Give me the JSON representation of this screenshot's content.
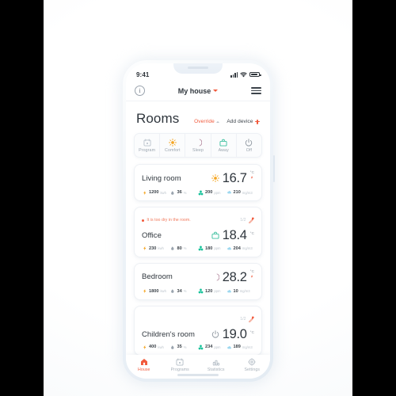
{
  "statusbar": {
    "time": "9:41",
    "signal_icon": "signal-bars-icon",
    "wifi_icon": "wifi-icon",
    "battery_icon": "battery-icon"
  },
  "appbar": {
    "info_icon": "info-icon",
    "info_glyph": "i",
    "title": "My house",
    "caret_icon": "caret-down-icon",
    "menu_icon": "hamburger-menu-icon"
  },
  "header": {
    "title": "Rooms",
    "override_label": "Override",
    "override_chevron": "chevron-up-icon",
    "add_device_label": "Add device",
    "add_device_icon": "plus-icon"
  },
  "modes": [
    {
      "label": "Program",
      "icon": "calendar-icon",
      "color": "#b9c2cb",
      "active": false
    },
    {
      "label": "Comfort",
      "icon": "sun-icon",
      "color": "#f5a623",
      "active": false
    },
    {
      "label": "Sleep",
      "icon": "moon-icon",
      "color": "#a8768f",
      "active": false
    },
    {
      "label": "Away",
      "icon": "briefcase-icon",
      "color": "#3fc0a0",
      "active": false
    },
    {
      "label": "Off",
      "icon": "power-icon",
      "color": "#8d969f",
      "active": false
    }
  ],
  "rooms": [
    {
      "name": "Living room",
      "mode_icon": "sun-icon",
      "mode_color": "#f5a623",
      "temperature": "16.7",
      "unit": "°C",
      "heating_icon": "flame-icon",
      "alert": null,
      "count": null,
      "metrics": [
        {
          "icon": "bolt-icon",
          "color": "#f5a623",
          "value": "1200",
          "unit": "kwh"
        },
        {
          "icon": "humidity-icon",
          "color": "#9aa4ae",
          "value": "36",
          "unit": "%"
        },
        {
          "icon": "co2-icon",
          "color": "#17c29a",
          "value": "200",
          "unit": "ppm"
        },
        {
          "icon": "dust-icon",
          "color": "#9ed8ef",
          "value": "210",
          "unit": "mg/m3"
        }
      ]
    },
    {
      "name": "Office",
      "mode_icon": "briefcase-icon",
      "mode_color": "#3fc0a0",
      "temperature": "18.4",
      "unit": "°C",
      "heating_icon": null,
      "alert": "It is too dry in the room.",
      "count": "1/2",
      "count_icon": "dry-air-icon",
      "metrics": [
        {
          "icon": "bolt-icon",
          "color": "#f5a623",
          "value": "230",
          "unit": "kwh"
        },
        {
          "icon": "humidity-icon",
          "color": "#9aa4ae",
          "value": "80",
          "unit": "%"
        },
        {
          "icon": "co2-icon",
          "color": "#17c29a",
          "value": "180",
          "unit": "ppm"
        },
        {
          "icon": "dust-icon",
          "color": "#9ed8ef",
          "value": "204",
          "unit": "mg/m3"
        }
      ]
    },
    {
      "name": "Bedroom",
      "mode_icon": "moon-icon",
      "mode_color": "#a8768f",
      "temperature": "28.2",
      "unit": "°C",
      "heating_icon": "flame-icon",
      "alert": null,
      "count": null,
      "metrics": [
        {
          "icon": "bolt-icon",
          "color": "#f5a623",
          "value": "1800",
          "unit": "kwh"
        },
        {
          "icon": "humidity-icon",
          "color": "#9aa4ae",
          "value": "34",
          "unit": "%"
        },
        {
          "icon": "co2-icon",
          "color": "#17c29a",
          "value": "120",
          "unit": "ppm"
        },
        {
          "icon": "dust-icon",
          "color": "#9ed8ef",
          "value": "10",
          "unit": "mg/m3"
        }
      ]
    },
    {
      "name": "Children's room",
      "mode_icon": "power-icon",
      "mode_color": "#8d969f",
      "temperature": "19.0",
      "unit": "°C",
      "heating_icon": null,
      "alert": null,
      "count": "1/2",
      "count_icon": "dry-air-icon",
      "metrics": [
        {
          "icon": "bolt-icon",
          "color": "#f5a623",
          "value": "400",
          "unit": "kwh"
        },
        {
          "icon": "humidity-icon",
          "color": "#9aa4ae",
          "value": "35",
          "unit": "%"
        },
        {
          "icon": "co2-icon",
          "color": "#17c29a",
          "value": "234",
          "unit": "ppm"
        },
        {
          "icon": "dust-icon",
          "color": "#9ed8ef",
          "value": "189",
          "unit": "mg/m3"
        }
      ]
    }
  ],
  "tabs": [
    {
      "label": "House",
      "icon": "home-icon",
      "active": true
    },
    {
      "label": "Programs",
      "icon": "calendar-icon",
      "active": false
    },
    {
      "label": "Statistics",
      "icon": "bar-chart-icon",
      "active": false
    },
    {
      "label": "Settings",
      "icon": "gear-icon",
      "active": false
    }
  ],
  "colors": {
    "accent": "#f15a3c",
    "text": "#2e353c",
    "muted": "#a7b0b9",
    "frame": "#e3ebf3"
  }
}
